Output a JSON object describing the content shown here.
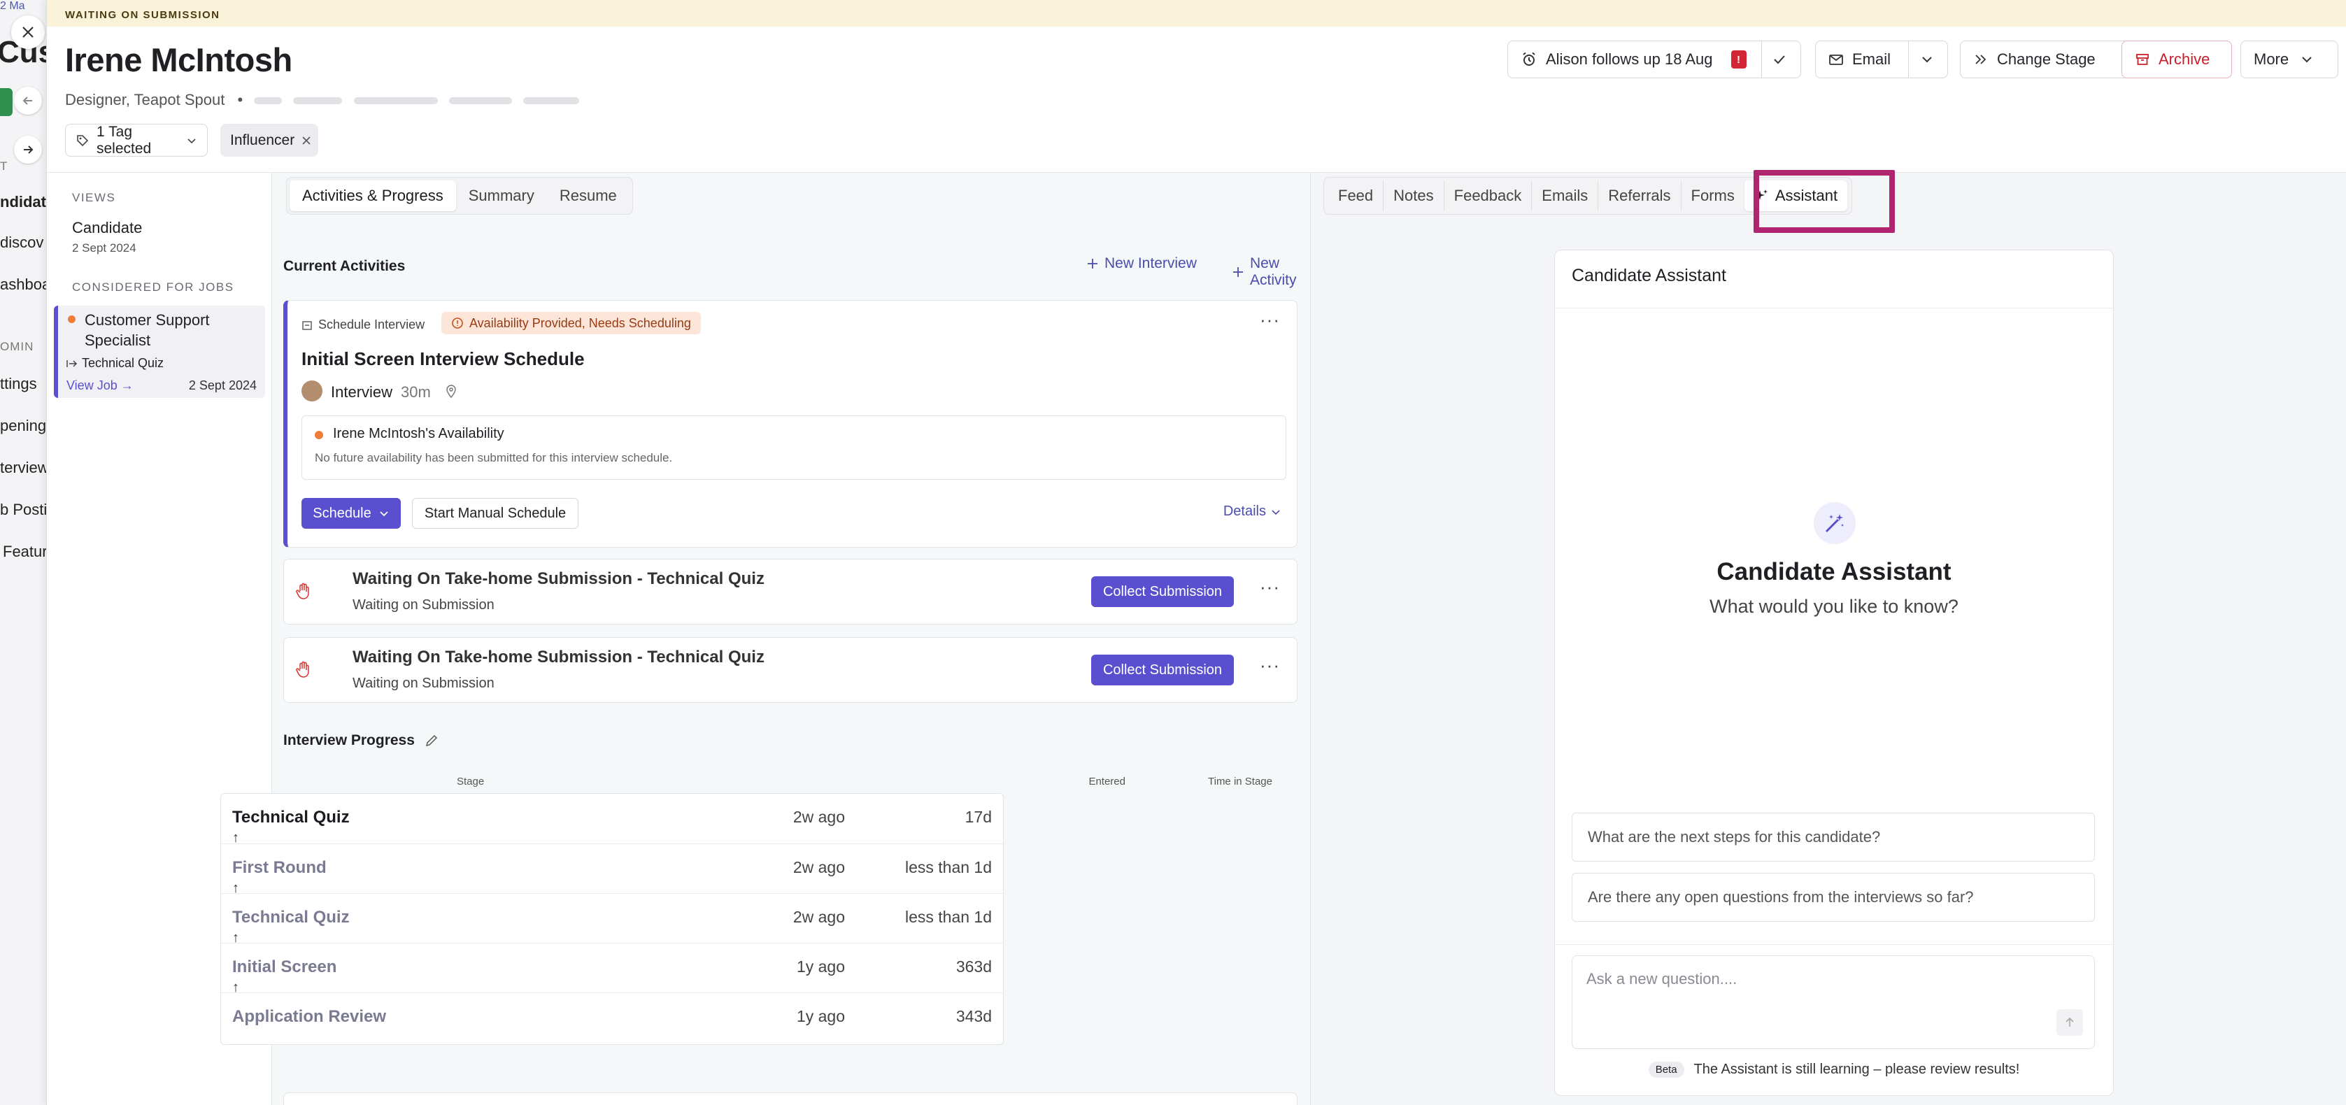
{
  "background_app": {
    "top_text": "2 Ma",
    "title_fragment": "Cust",
    "nav_items": [
      "ndidat",
      "discov",
      "ashboa",
      "ttings",
      "penings",
      "terview",
      "b Postir",
      "Featur"
    ],
    "section_labels": [
      "T",
      "OMIN"
    ]
  },
  "banner": {
    "text": "WAITING ON SUBMISSION"
  },
  "candidate": {
    "name": "Irene McIntosh",
    "subtitle": "Designer, Teapot Spout",
    "bullet": "•"
  },
  "header_actions": {
    "followup": "Alison follows up 18 Aug",
    "followup_alert": "!",
    "email": "Email",
    "change_stage": "Change Stage",
    "archive": "Archive",
    "more": "More"
  },
  "tags": {
    "selected": "1 Tag selected",
    "chips": [
      "Influencer"
    ]
  },
  "left_panel": {
    "views_label": "VIEWS",
    "view_name": "Candidate",
    "view_date": "2 Sept 2024",
    "considered_label": "CONSIDERED FOR JOBS",
    "job_title_line1": "Customer Support",
    "job_title_line2": "Specialist",
    "job_stage": "Technical Quiz",
    "view_job": "View Job →",
    "job_date": "2 Sept 2024"
  },
  "middle_tabs": [
    "Activities & Progress",
    "Summary",
    "Resume"
  ],
  "current_activities": {
    "heading": "Current Activities",
    "new_interview": "New Interview",
    "new_activity": "New Activity"
  },
  "schedule_card": {
    "type_label": "Schedule Interview",
    "status_badge": "Availability Provided, Needs Scheduling",
    "title": "Initial Screen Interview Schedule",
    "interview_label": "Interview",
    "duration": "30m",
    "availability_title": "Irene McIntosh's Availability",
    "availability_note": "No future availability has been submitted for this interview schedule.",
    "schedule_btn": "Schedule",
    "manual_btn": "Start Manual Schedule",
    "details": "Details"
  },
  "waiting_cards": [
    {
      "title": "Waiting On Take-home Submission - Technical Quiz",
      "status": "Waiting on Submission",
      "action": "Collect Submission"
    },
    {
      "title": "Waiting On Take-home Submission - Technical Quiz",
      "status": "Waiting on Submission",
      "action": "Collect Submission"
    }
  ],
  "interview_progress": {
    "heading": "Interview Progress",
    "columns": [
      "Stage",
      "Entered",
      "Time in Stage"
    ],
    "rows": [
      {
        "stage": "Technical Quiz",
        "entered": "2w ago",
        "time": "17d",
        "current": true
      },
      {
        "stage": "First Round",
        "entered": "2w ago",
        "time": "less than 1d",
        "current": false
      },
      {
        "stage": "Technical Quiz",
        "entered": "2w ago",
        "time": "less than 1d",
        "current": false
      },
      {
        "stage": "Initial Screen",
        "entered": "1y ago",
        "time": "363d",
        "current": false
      },
      {
        "stage": "Application Review",
        "entered": "1y ago",
        "time": "343d",
        "current": false
      }
    ],
    "arrow": "↑"
  },
  "right_tabs": [
    "Feed",
    "Notes",
    "Feedback",
    "Emails",
    "Referrals",
    "Forms",
    "Assistant"
  ],
  "assistant": {
    "card_title": "Candidate Assistant",
    "hero_title": "Candidate Assistant",
    "hero_subtitle": "What would you like to know?",
    "suggestions": [
      "What are the next steps for this candidate?",
      "Are there any open questions from the interviews so far?"
    ],
    "input_placeholder": "Ask a new question....",
    "beta_badge": "Beta",
    "disclaimer": "The Assistant is still learning – please review results!"
  },
  "colors": {
    "accent": "#5a4fcf",
    "banner": "#fbf3d9",
    "archive_red": "#c8202b",
    "highlight": "#b0256e",
    "status_orange": "#f07c3a"
  }
}
